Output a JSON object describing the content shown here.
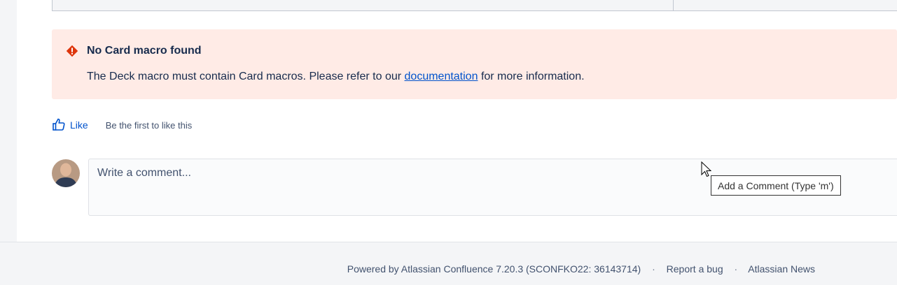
{
  "error": {
    "title": "No Card macro found",
    "body_before": "The Deck macro must contain Card macros. Please refer to our",
    "link": "documentation",
    "body_after": "for more information."
  },
  "like": {
    "label": "Like",
    "hint": "Be the first to like this"
  },
  "comment": {
    "placeholder": "Write a comment...",
    "tooltip": "Add a Comment (Type 'm')"
  },
  "footer": {
    "powered": "Powered by Atlassian Confluence 7.20.3 (SCONFKO22: 36143714)",
    "sep": "·",
    "report": "Report a bug",
    "news": "Atlassian News"
  },
  "colors": {
    "error_bg": "#ffebe6",
    "error_icon": "#de350b",
    "link": "#0052cc",
    "text": "#172b4d"
  }
}
